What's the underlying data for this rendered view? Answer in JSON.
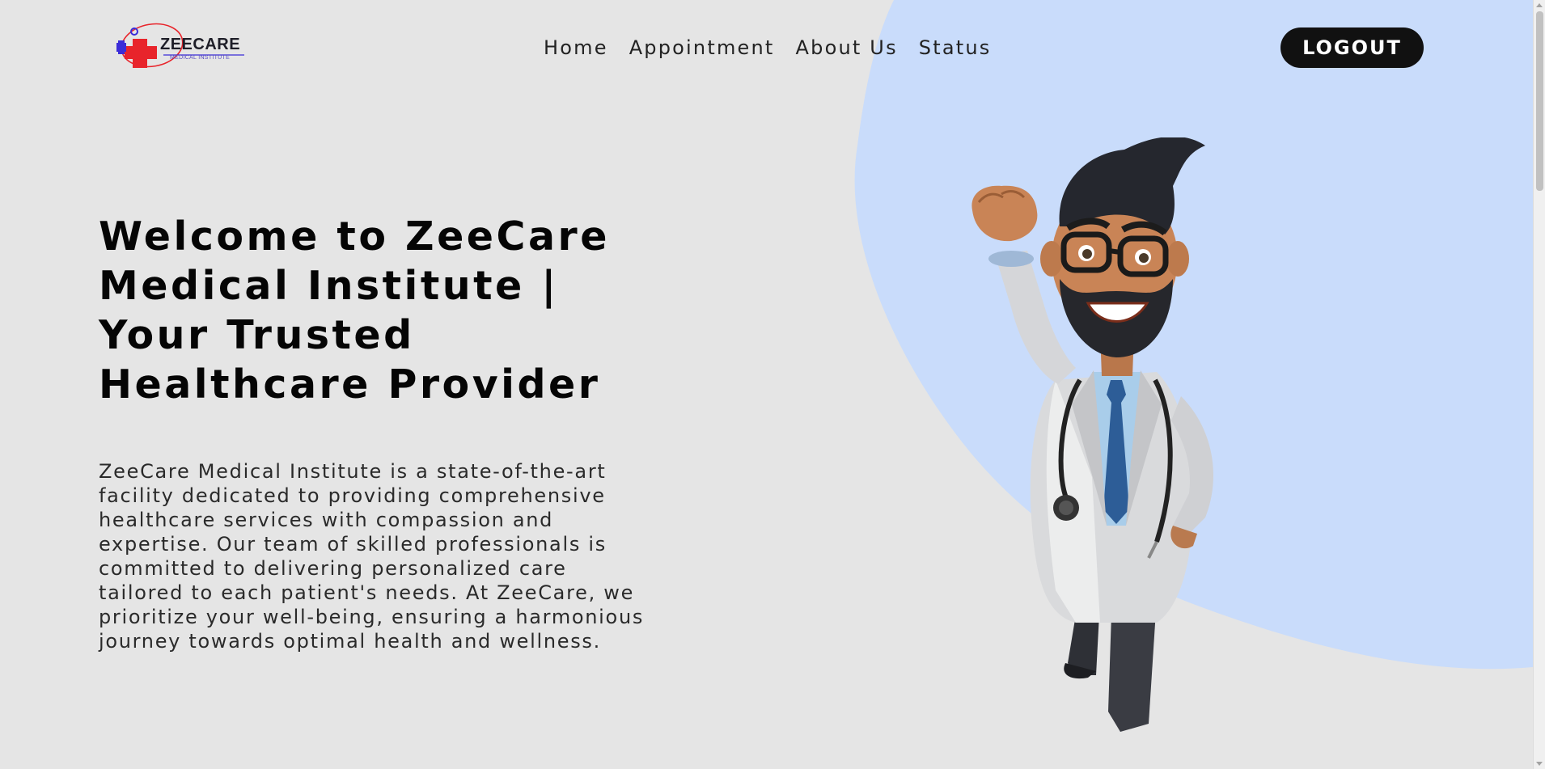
{
  "header": {
    "logo": {
      "name": "ZEECARE",
      "subtitle": "MEDICAL INSTITUTE",
      "icon": "medical-cross-logo-icon"
    },
    "nav": [
      {
        "label": "Home"
      },
      {
        "label": "Appointment"
      },
      {
        "label": "About Us"
      },
      {
        "label": "Status"
      }
    ],
    "logout_label": "LOGOUT"
  },
  "hero": {
    "title": "Welcome to ZeeCare Medical Institute | Your Trusted Healthcare Provider",
    "description": "ZeeCare Medical Institute is a state-of-the-art facility dedicated to providing comprehensive healthcare services with compassion and expertise. Our team of skilled professionals is committed to delivering personalized care tailored to each patient's needs. At ZeeCare, we prioritize your well-being, ensuring a harmonious journey towards optimal health and wellness.",
    "image": "superhero-doctor-illustration"
  },
  "colors": {
    "background": "#e5e5e5",
    "blob": "#c9dcfb",
    "button": "#111111",
    "logo_red": "#e8242b",
    "logo_blue": "#3b2cd8"
  }
}
